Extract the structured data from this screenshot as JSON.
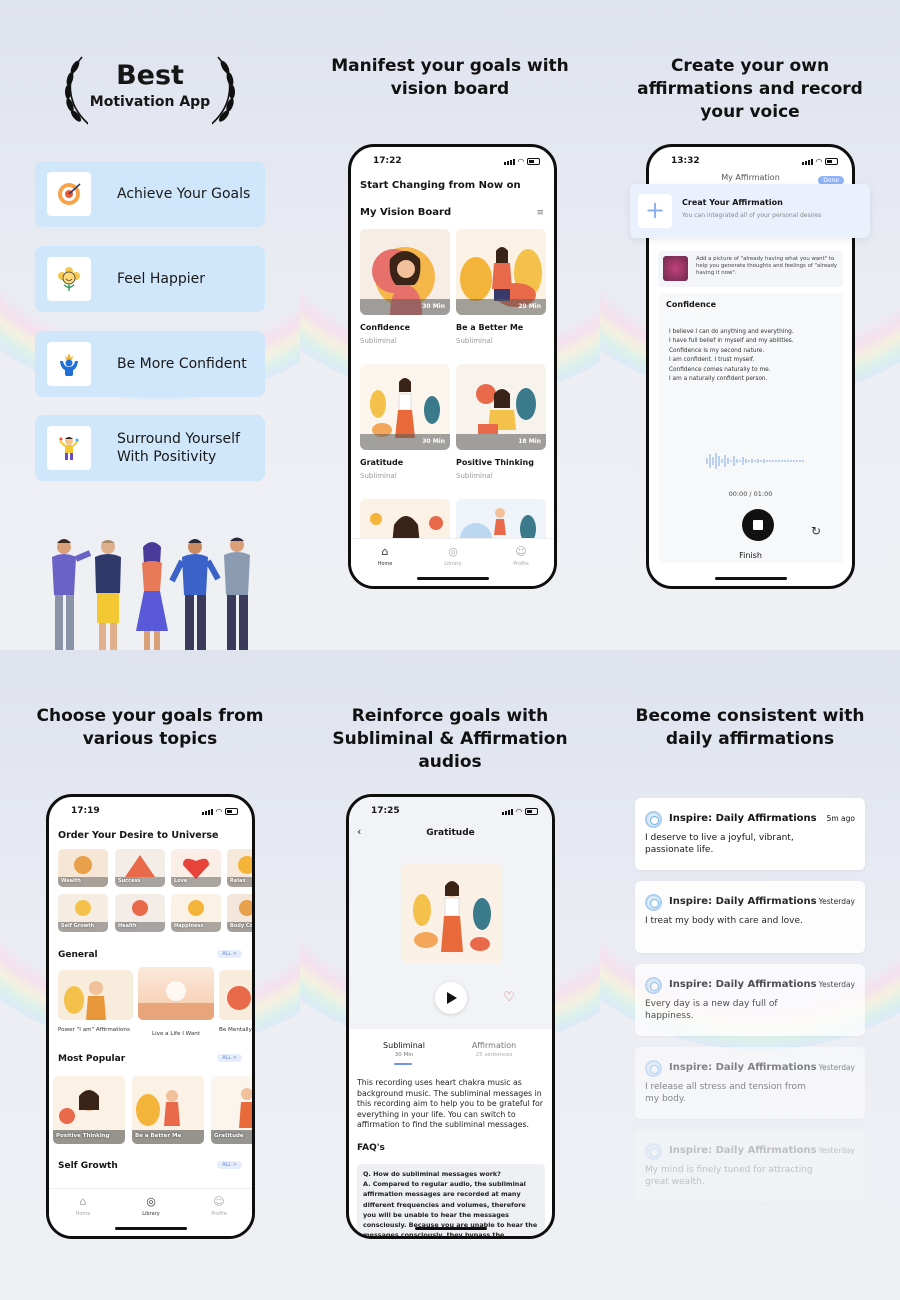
{
  "panel1": {
    "best": "Best",
    "subtitle": "Motivation App",
    "cards": [
      {
        "label": "Achieve Your Goals",
        "icon": "target-icon"
      },
      {
        "label": "Feel Happier",
        "icon": "smiling-flower-icon"
      },
      {
        "label": "Be More Confident",
        "icon": "confident-person-icon"
      },
      {
        "label": "Surround Yourself With Positivity",
        "icon": "happy-person-icon"
      }
    ],
    "accent_color": "#cfe6fb"
  },
  "panel2": {
    "title": "Manifest your goals with vision board",
    "time": "17:22",
    "heading": "Start Changing from Now on",
    "section": "My Vision Board",
    "tiles": [
      {
        "name": "Confidence",
        "sub": "Subliminal",
        "duration": "30 Min"
      },
      {
        "name": "Be a Better Me",
        "sub": "Subliminal",
        "duration": "20 Min"
      },
      {
        "name": "Gratitude",
        "sub": "Subliminal",
        "duration": "30 Min"
      },
      {
        "name": "Positive Thinking",
        "sub": "Subliminal",
        "duration": "18 Min"
      }
    ],
    "tabs": [
      "Home",
      "Library",
      "Profile"
    ]
  },
  "panel3": {
    "title": "Create your own affirmations and record your voice",
    "time": "13:32",
    "screen_title": "My Affirmation",
    "done": "Done",
    "popup_title": "Creat Your Affirmation",
    "popup_sub": "You can integrated all of your personal desires",
    "picture_hint": "Add a picture of \"already having what you want\" to help you generate thoughts and feelings of \"already having it now\".",
    "card_title": "Confidence",
    "affirmations": [
      "I believe I can do anything and everything.",
      "I have full belief in myself and my abilities.",
      "Confidence is my second nature.",
      "I am confident. I trust myself.",
      "Confidence comes naturally to me.",
      "I am a naturally confident person."
    ],
    "timer": "00:00 / 01:00",
    "finish": "Finish"
  },
  "panel4": {
    "title": "Choose your goals from various topics",
    "time": "17:19",
    "heading": "Order Your Desire to Universe",
    "categories": [
      "Wealth",
      "Success",
      "Love",
      "Relax",
      "Self Growth",
      "Health",
      "Happiness",
      "Body Co"
    ],
    "general": "General",
    "all": "ALL >",
    "general_items": [
      "Power \"I am\" Affirmations",
      "Live a Life I Want",
      "Be Mentally & Physically"
    ],
    "most_popular": "Most Popular",
    "popular_items": [
      "Positive Thinking",
      "Be a Better Me",
      "Gratitude"
    ],
    "self_growth": "Self Growth",
    "tabs": [
      "Home",
      "Library",
      "Profile"
    ]
  },
  "panel5": {
    "title": "Reinforce goals with Subliminal & Affirmation audios",
    "time": "17:25",
    "screen_title": "Gratitude",
    "tab1": "Subliminal",
    "tab1_sub": "30 Min",
    "tab2": "Affirmation",
    "tab2_sub": "25 sentences",
    "description": "This recording uses heart chakra music as background music. The subliminal messages in this recording aim to help you to be grateful for everything in your life. You can switch to affirmation to find the subliminal messages.",
    "faq": "FAQ's",
    "faq_q": "Q. How do subliminal messages work?",
    "faq_a": "A. Compared to regular audio, the subliminal affirmation messages are recorded at many different frequencies and volumes, therefore you will be unable to hear the messages consciously. Because you are unable to hear the messages consciously, they bypass the"
  },
  "panel6": {
    "title": "Become consistent with daily affirmations",
    "notifications": [
      {
        "app": "Inspire: Daily Affirmations",
        "time": "5m ago",
        "body": "I deserve to live a joyful, vibrant, passionate life."
      },
      {
        "app": "Inspire: Daily Affirmations",
        "time": "Yesterday",
        "body": "I treat my body with care and love."
      },
      {
        "app": "Inspire: Daily Affirmations",
        "time": "Yesterday",
        "body": "Every day is a new day full of happiness."
      },
      {
        "app": "Inspire: Daily Affirmations",
        "time": "Yesterday",
        "body": "I release all stress and tension from my body."
      },
      {
        "app": "Inspire: Daily Affirmations",
        "time": "Yesterday",
        "body": "My mind is finely tuned for attracting great wealth."
      }
    ]
  }
}
